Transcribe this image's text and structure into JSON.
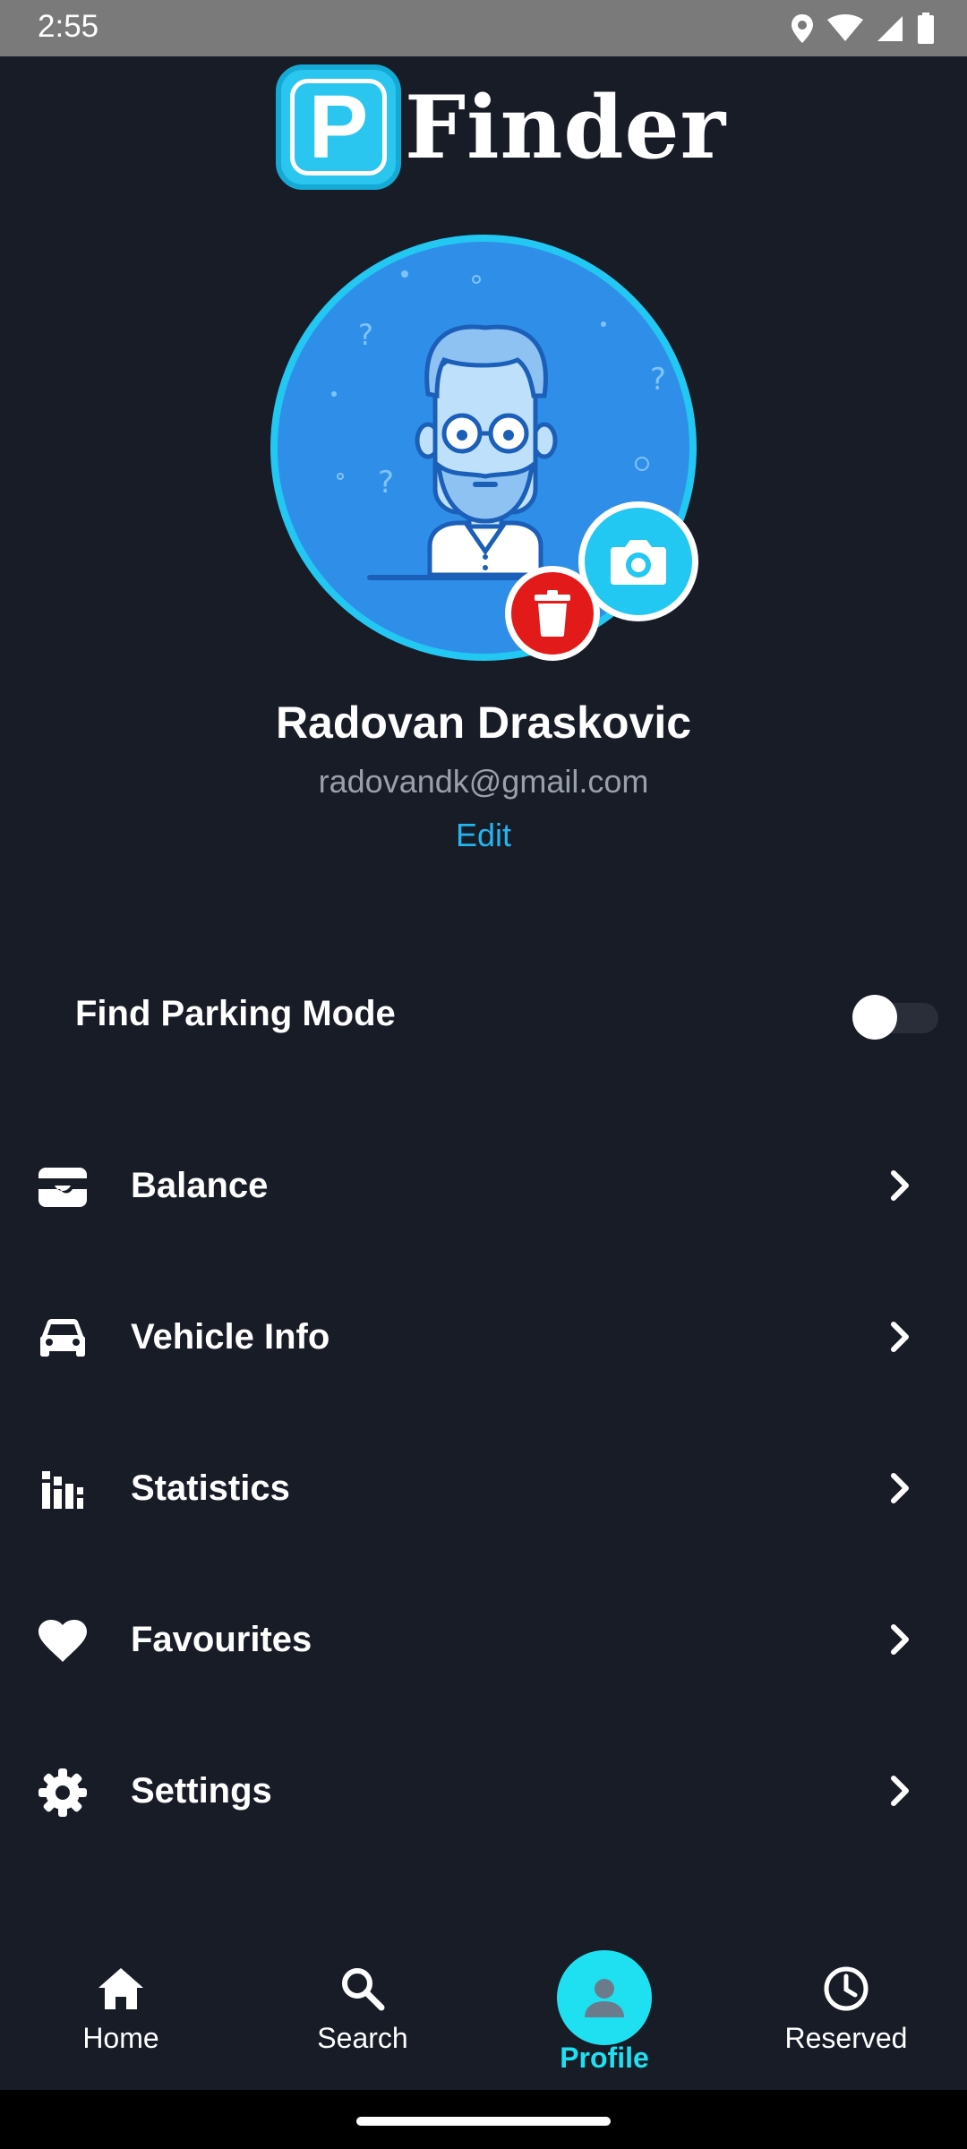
{
  "status_bar": {
    "time": "2:55",
    "icons": [
      "location-icon",
      "wifi-icon",
      "signal-icon",
      "battery-icon"
    ]
  },
  "app": {
    "logo_letter": "P",
    "logo_text": "Finder",
    "brand_color": "#22c7f2"
  },
  "profile": {
    "name": "Radovan Draskovic",
    "email": "radovandk@gmail.com",
    "edit_label": "Edit"
  },
  "find_parking_mode": {
    "label": "Find Parking Mode",
    "enabled": false
  },
  "menu": [
    {
      "label": "Balance",
      "icon": "wallet-icon"
    },
    {
      "label": "Vehicle Info",
      "icon": "car-icon"
    },
    {
      "label": "Statistics",
      "icon": "stats-icon"
    },
    {
      "label": "Favourites",
      "icon": "heart-icon"
    },
    {
      "label": "Settings",
      "icon": "gear-icon"
    }
  ],
  "bottom_nav": [
    {
      "label": "Home",
      "icon": "home-icon",
      "active": false
    },
    {
      "label": "Search",
      "icon": "search-icon",
      "active": false
    },
    {
      "label": "Profile",
      "icon": "person-icon",
      "active": true
    },
    {
      "label": "Reserved",
      "icon": "clock-icon",
      "active": false
    }
  ],
  "colors": {
    "background": "#181c27",
    "accent": "#1ee0f0",
    "link": "#22b5ee",
    "danger": "#e31a1a"
  }
}
